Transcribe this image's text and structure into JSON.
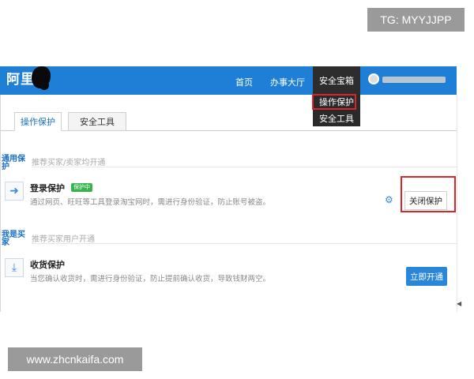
{
  "watermarks": {
    "tg": "TG: MYYJJPP",
    "site": "www.zhcnkaifa.com"
  },
  "header": {
    "logo": "阿里",
    "nav": [
      {
        "label": "首页"
      },
      {
        "label": "办事大厅"
      },
      {
        "label": "安全宝箱",
        "active": true
      }
    ]
  },
  "dropdown": {
    "items": [
      "操作保护",
      "安全工具"
    ]
  },
  "tabs": [
    "操作保护",
    "安全工具"
  ],
  "sections": [
    {
      "title": "通用保护",
      "subtitle": "推荐买家/卖家均开通",
      "row": {
        "title": "登录保护",
        "badge": "保护中",
        "desc": "通过网页、旺旺等工具登录淘宝网时，需进行身份验证，防止账号被盗。",
        "action": "关闭保护"
      }
    },
    {
      "title": "我是买家",
      "subtitle": "推荐买家用户开通",
      "row": {
        "title": "收货保护",
        "desc": "当您确认收货时，需进行身份验证，防止提前确认收货，导致钱财两空。",
        "action": "立即开通"
      }
    }
  ],
  "colors": {
    "header_bg": "#1f7fd6",
    "highlight_border": "#d9262b",
    "link_blue": "#1a6fc4",
    "badge_green": "#36b34a"
  },
  "icons": [
    "login-arrow-icon",
    "download-arrow-icon",
    "settings-gear-icon"
  ]
}
